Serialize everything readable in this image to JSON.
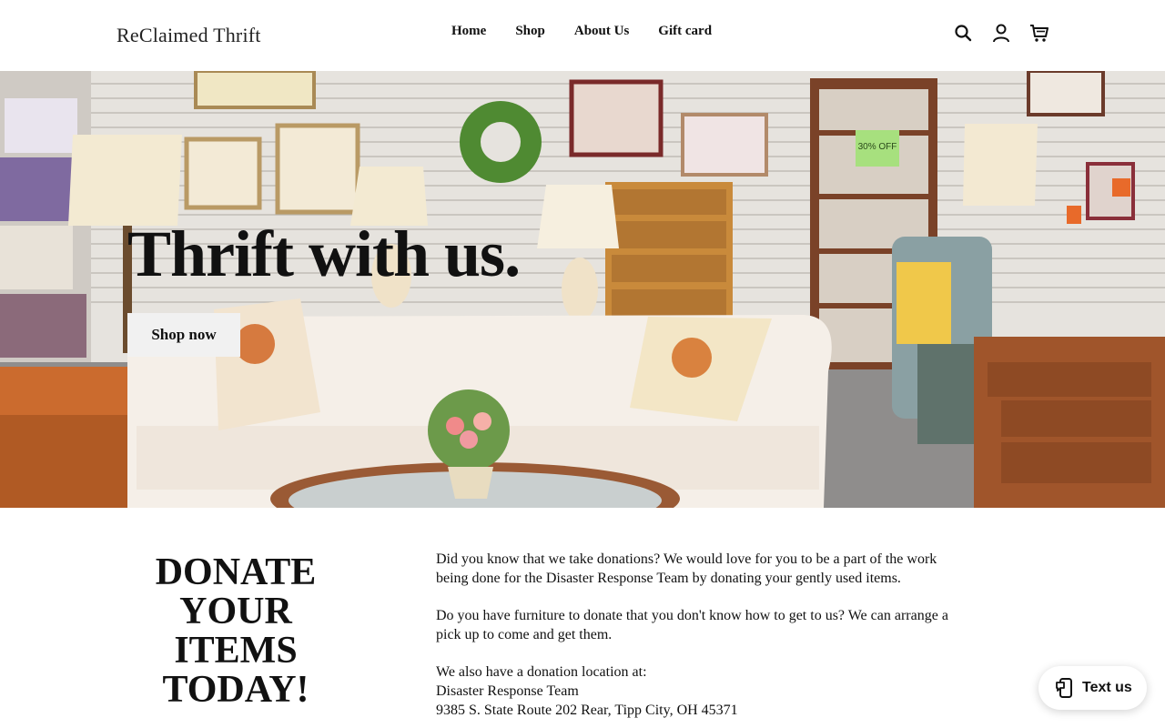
{
  "brand": {
    "name": "ReClaimed Thrift"
  },
  "nav": {
    "items": [
      {
        "label": "Home"
      },
      {
        "label": "Shop"
      },
      {
        "label": "About Us"
      },
      {
        "label": "Gift card"
      }
    ]
  },
  "header_icons": [
    "search-icon",
    "account-icon",
    "cart-icon"
  ],
  "hero": {
    "title": "Thrift with us.",
    "button_label": "Shop now",
    "sign_text": "30% OFF"
  },
  "donate": {
    "title_lines": [
      "DONATE",
      "YOUR ITEMS",
      "TODAY!"
    ],
    "paragraphs": [
      "Did you know that we take donations? We would love for you to be a part of the work being done for the Disaster Response Team by donating your gently used items.",
      "Do you have furniture to donate that you don't know how to get to us? We can arrange a pick up to come and get them."
    ],
    "address_lines": [
      "We also have a donation location at:",
      "Disaster Response Team",
      "9385 S. State Route 202 Rear, Tipp City, OH 45371"
    ]
  },
  "widget": {
    "label": "Text us"
  },
  "colors": {
    "background": "#ffffff",
    "text": "#111111",
    "button_bg": "#f1f1f1"
  }
}
